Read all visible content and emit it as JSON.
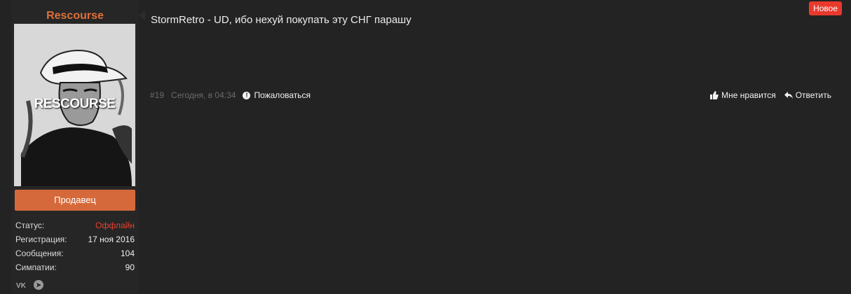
{
  "user": {
    "name": "Rescourse",
    "avatar_text": "RESCOURSE",
    "role": "Продавец",
    "stats": [
      {
        "label": "Статус:",
        "value": "Оффлайн"
      },
      {
        "label": "Регистрация:",
        "value": "17 ноя 2016"
      },
      {
        "label": "Сообщения:",
        "value": "104"
      },
      {
        "label": "Симпатии:",
        "value": "90"
      }
    ],
    "social": {
      "vk": "vk-icon",
      "telegram": "telegram-icon"
    }
  },
  "post": {
    "badge": "Новое",
    "text": "StormRetro - UD, ибо нехуй покупать эту СНГ парашу",
    "number": "#19",
    "date": "Сегодня, в 04:34",
    "report": "Пожаловаться",
    "like": "Мне нравится",
    "reply": "Ответить"
  },
  "colors": {
    "accent": "#d6693b",
    "username": "#e0703a",
    "offline": "#e8412c",
    "badge": "#e9392c"
  }
}
